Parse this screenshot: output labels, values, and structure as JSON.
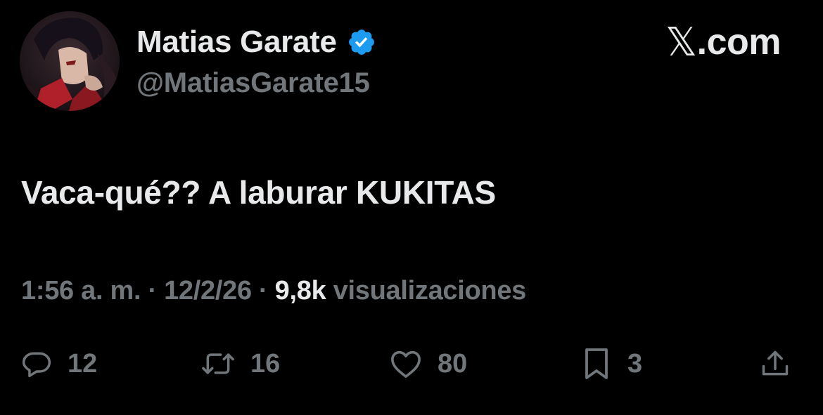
{
  "author": {
    "display_name": "Matias Garate",
    "handle": "@MatiasGarate15",
    "verified": true
  },
  "brand": {
    "x_glyph": "𝕏",
    "domain": ".com"
  },
  "tweet": {
    "text": "Vaca-qué?? A laburar KUKITAS"
  },
  "meta": {
    "time": "1:56 a. m.",
    "separator": " · ",
    "date": "12/2/26",
    "views_count": "9,8k",
    "views_label": " visualizaciones"
  },
  "actions": {
    "replies": "12",
    "reposts": "16",
    "likes": "80",
    "bookmarks": "3"
  },
  "colors": {
    "background": "#000000",
    "primary_text": "#e7e9ea",
    "secondary_text": "#71767b",
    "verified_blue": "#1d9bf0"
  }
}
